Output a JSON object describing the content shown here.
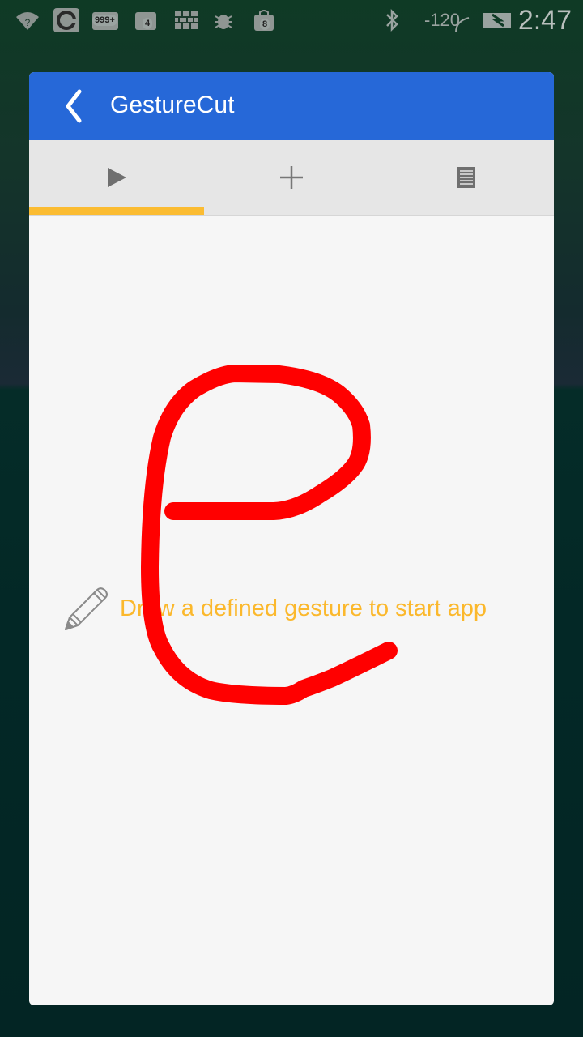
{
  "statusbar": {
    "badge_999": "999+",
    "badge_4": "4",
    "badge_8": "8",
    "signal_text": "-120",
    "clock": "2:47"
  },
  "appbar": {
    "title": "GestureCut",
    "back_icon": "chevron-left-icon"
  },
  "tabs": [
    {
      "icon": "play-icon",
      "selected": true
    },
    {
      "icon": "plus-icon",
      "selected": false
    },
    {
      "icon": "list-icon",
      "selected": false
    }
  ],
  "canvas": {
    "hint_icon": "pencil-icon",
    "hint_text": "Draw a defined gesture to start app",
    "gesture_letter": "e"
  },
  "colors": {
    "appbar": "#2668d8",
    "tab_indicator": "#fbbc32",
    "hint_text": "#fbb82c",
    "gesture_stroke": "#ff0000",
    "canvas_bg": "#f6f6f6"
  }
}
